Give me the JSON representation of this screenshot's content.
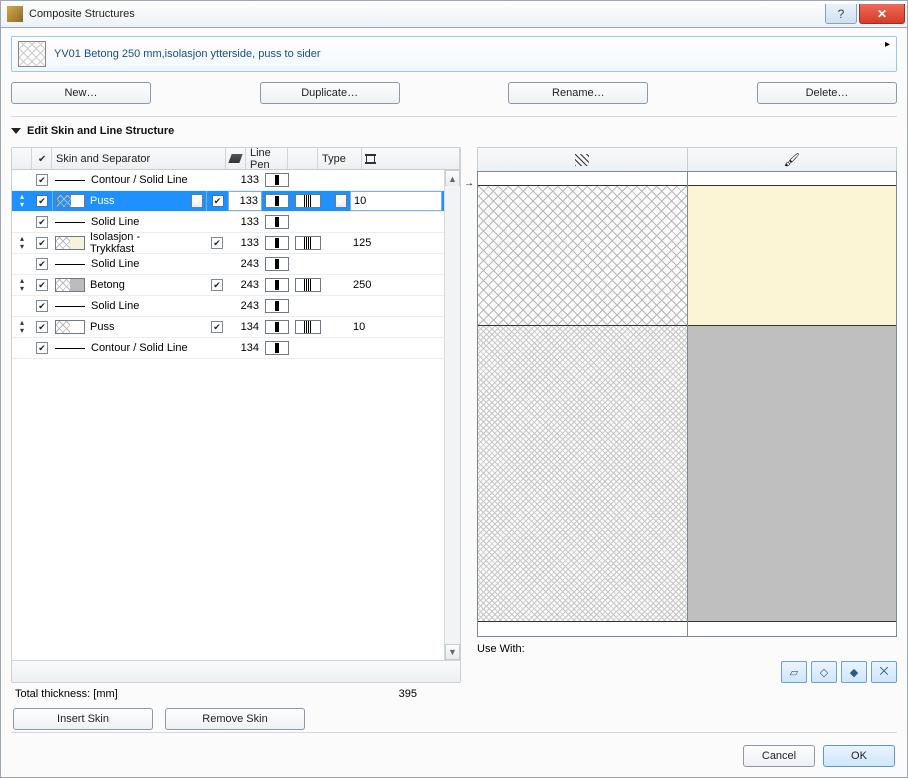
{
  "window": {
    "title": "Composite Structures"
  },
  "composite": {
    "name": "YV01 Betong 250 mm,isolasjon ytterside, puss to sider"
  },
  "buttons": {
    "new": "New…",
    "duplicate": "Duplicate…",
    "rename": "Rename…",
    "delete": "Delete…",
    "insert_skin": "Insert Skin",
    "remove_skin": "Remove Skin",
    "cancel": "Cancel",
    "ok": "OK"
  },
  "section": {
    "title": "Edit Skin and Line Structure"
  },
  "columns": {
    "skin_sep": "Skin and Separator",
    "line_pen": "Line Pen",
    "type": "Type"
  },
  "rows": [
    {
      "kind": "line",
      "name": "Contour / Solid Line",
      "pen": "133",
      "checked": true
    },
    {
      "kind": "skin",
      "name": "Puss",
      "pen": "133",
      "thick": "10",
      "swatch": "white",
      "checked": true,
      "selected": true,
      "flag": true
    },
    {
      "kind": "line",
      "name": "Solid Line",
      "pen": "133",
      "checked": true
    },
    {
      "kind": "skin",
      "name": "Isolasjon - Trykkfast",
      "pen": "133",
      "thick": "125",
      "swatch": "iso",
      "checked": true,
      "flag": true
    },
    {
      "kind": "line",
      "name": "Solid Line",
      "pen": "243",
      "checked": true
    },
    {
      "kind": "skin",
      "name": "Betong",
      "pen": "243",
      "thick": "250",
      "swatch": "gray",
      "checked": true,
      "flag": true
    },
    {
      "kind": "line",
      "name": "Solid Line",
      "pen": "243",
      "checked": true
    },
    {
      "kind": "skin",
      "name": "Puss",
      "pen": "134",
      "thick": "10",
      "swatch": "white",
      "checked": true,
      "flag": true
    },
    {
      "kind": "line",
      "name": "Contour / Solid Line",
      "pen": "134",
      "checked": true
    }
  ],
  "totals": {
    "label": "Total thickness: [mm]",
    "value": "395"
  },
  "use_with": {
    "label": "Use With:"
  }
}
